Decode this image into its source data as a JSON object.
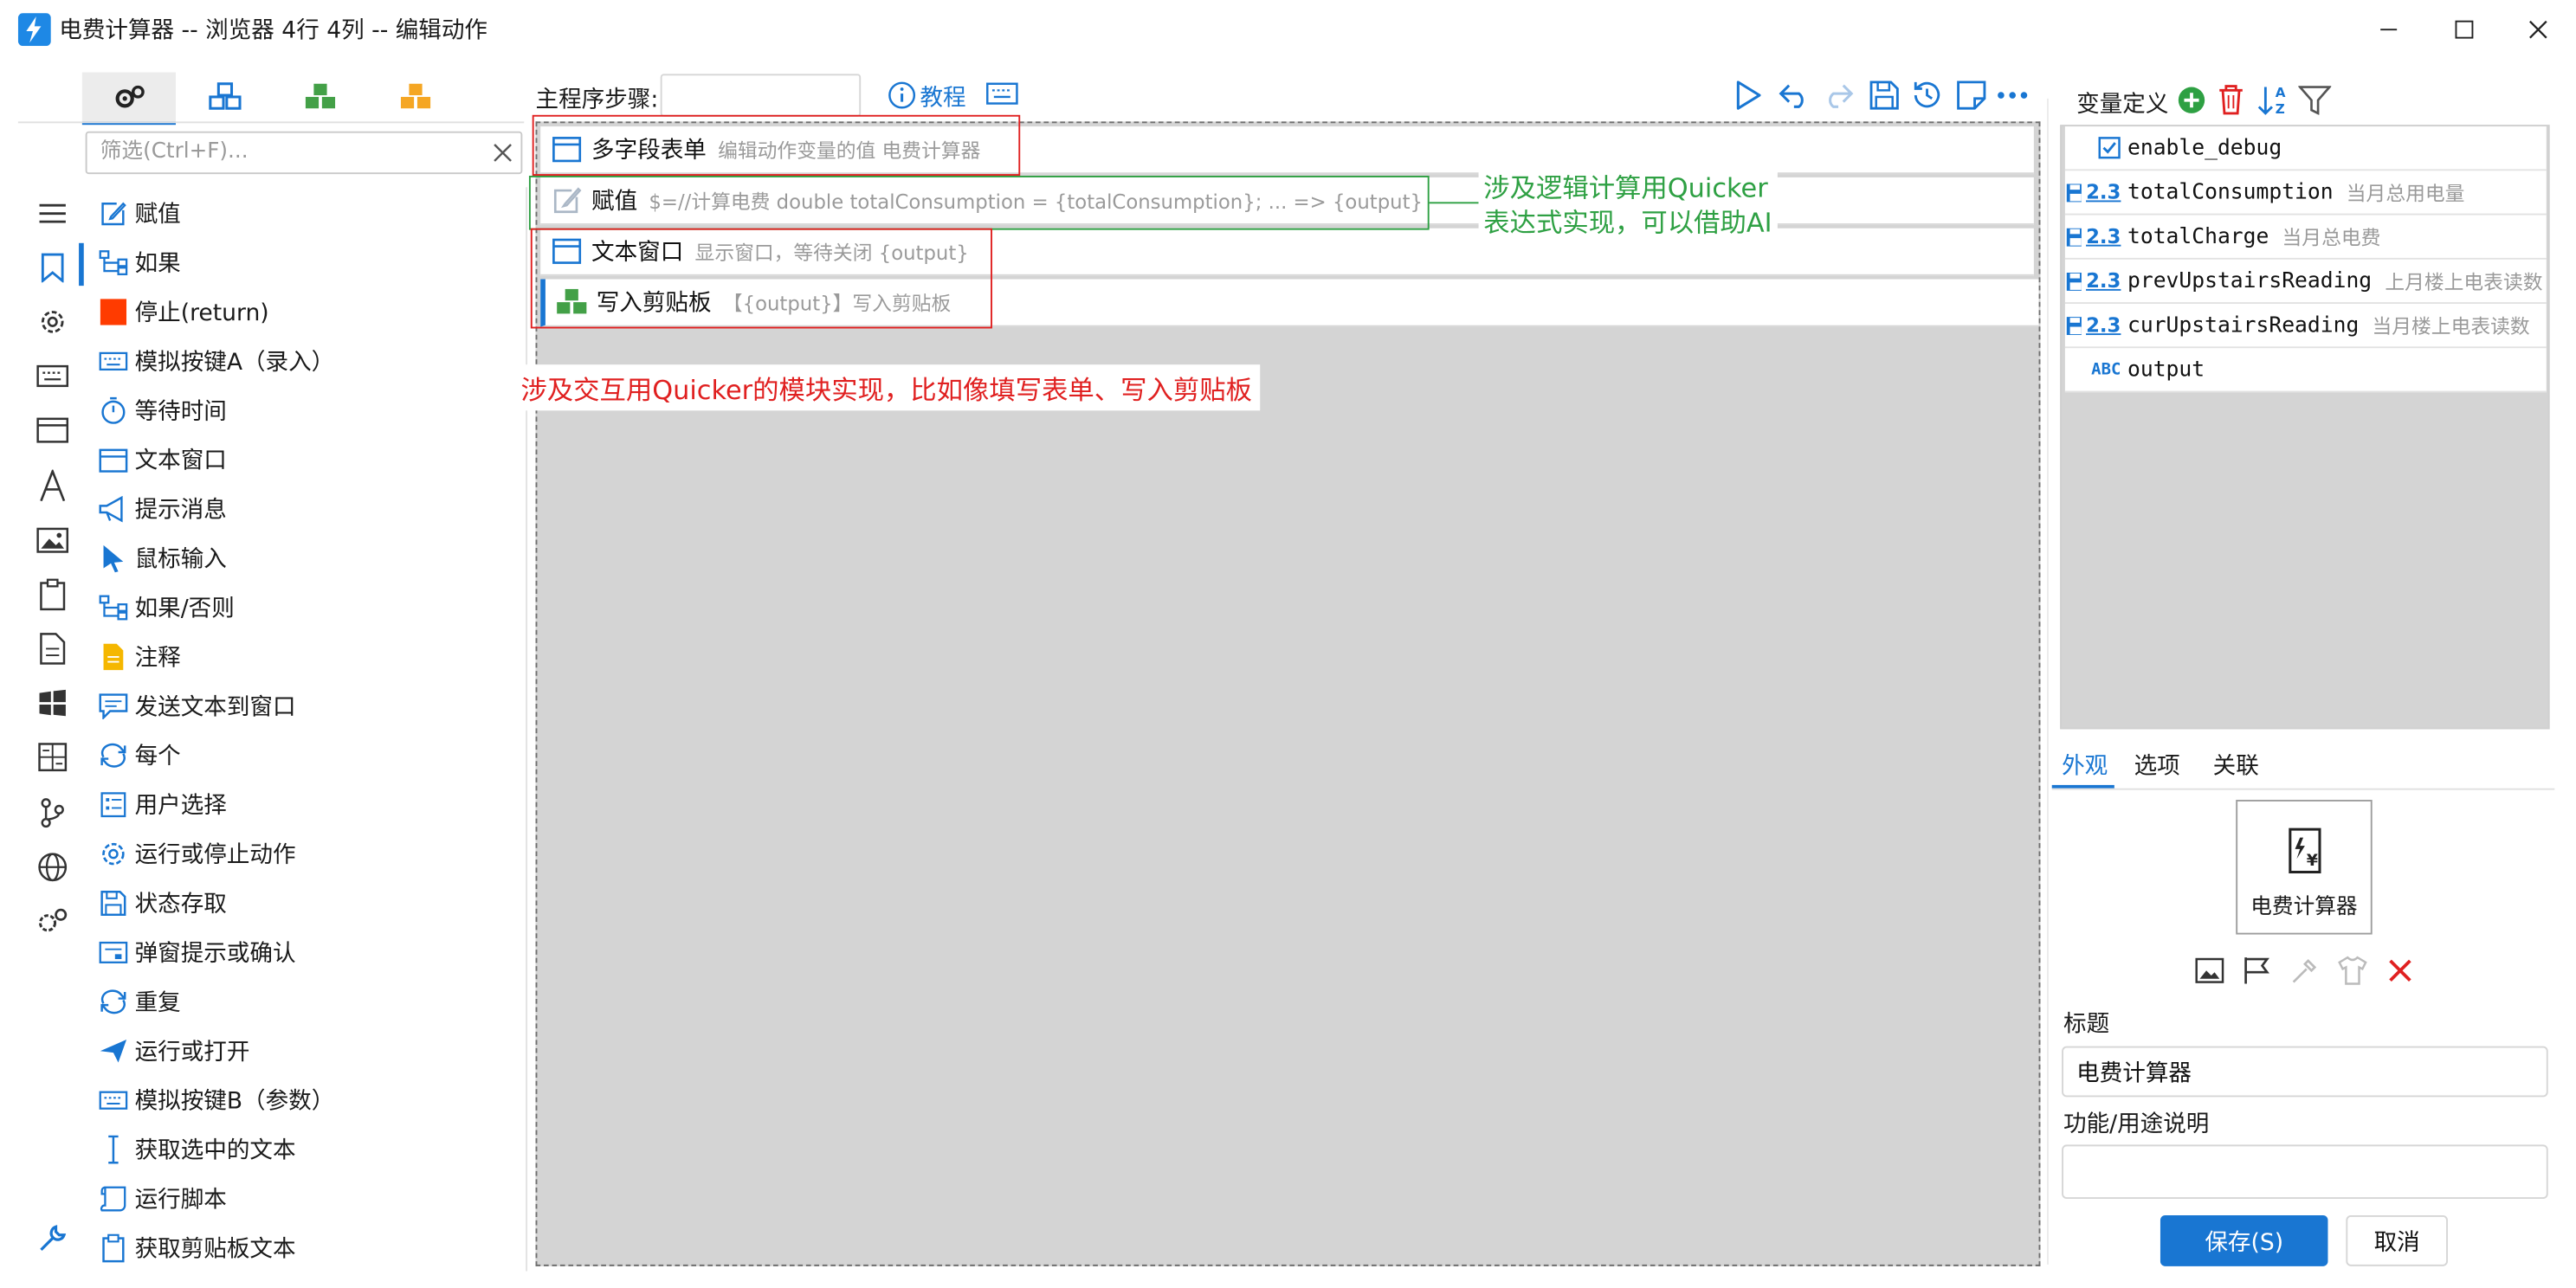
{
  "window": {
    "title": "电费计算器 -- 浏览器 4行 4列 -- 编辑动作"
  },
  "left_panel": {
    "filter_placeholder": "筛选(Ctrl+F)...",
    "actions": [
      {
        "label": "赋值",
        "icon": "edit-icon"
      },
      {
        "label": "如果",
        "icon": "branch-icon"
      },
      {
        "label": "停止(return)",
        "icon": "stop-icon"
      },
      {
        "label": "模拟按键A（录入）",
        "icon": "keyboard-icon"
      },
      {
        "label": "等待时间",
        "icon": "timer-icon"
      },
      {
        "label": "文本窗口",
        "icon": "window-icon"
      },
      {
        "label": "提示消息",
        "icon": "megaphone-icon"
      },
      {
        "label": "鼠标输入",
        "icon": "cursor-icon"
      },
      {
        "label": "如果/否则",
        "icon": "branch-icon"
      },
      {
        "label": "注释",
        "icon": "note-icon"
      },
      {
        "label": "发送文本到窗口",
        "icon": "message-icon"
      },
      {
        "label": "每个",
        "icon": "loop-icon"
      },
      {
        "label": "用户选择",
        "icon": "list-icon"
      },
      {
        "label": "运行或停止动作",
        "icon": "gear-icon"
      },
      {
        "label": "状态存取",
        "icon": "save-icon"
      },
      {
        "label": "弹窗提示或确认",
        "icon": "dialog-icon"
      },
      {
        "label": "重复",
        "icon": "loop-icon"
      },
      {
        "label": "运行或打开",
        "icon": "send-icon"
      },
      {
        "label": "模拟按键B（参数）",
        "icon": "keyboard-icon"
      },
      {
        "label": "获取选中的文本",
        "icon": "text-cursor-icon"
      },
      {
        "label": "运行脚本",
        "icon": "script-icon"
      },
      {
        "label": "获取剪贴板文本",
        "icon": "clipboard-icon"
      }
    ]
  },
  "main": {
    "label": "主程序步骤:",
    "tutorial_label": "教程",
    "steps": [
      {
        "title": "多字段表单",
        "desc": "编辑动作变量的值 电费计算器",
        "icon": "window-icon"
      },
      {
        "title": "赋值",
        "desc": "$=//计算电费  double totalConsumption = {totalConsumption};  ... => {output}",
        "icon": "edit-icon"
      },
      {
        "title": "文本窗口",
        "desc": "显示窗口，等待关闭 {output}",
        "icon": "window-icon"
      },
      {
        "title": "写入剪贴板",
        "desc": "【{output}】写入剪贴板",
        "icon": "module-icon"
      }
    ],
    "green_note": [
      "涉及逻辑计算用Quicker",
      "表达式实现，可以借助AI"
    ],
    "red_note": "涉及交互用Quicker的模块实现，比如像填写表单、写入剪贴板"
  },
  "right_panel": {
    "var_title": "变量定义",
    "variables": [
      {
        "name": "enable_debug",
        "desc": "",
        "type": "bool"
      },
      {
        "name": "totalConsumption",
        "desc": "当月总用电量",
        "type": "number"
      },
      {
        "name": "totalCharge",
        "desc": "当月总电费",
        "type": "number"
      },
      {
        "name": "prevUpstairsReading",
        "desc": "上月楼上电表读数",
        "type": "number"
      },
      {
        "name": "curUpstairsReading",
        "desc": "当月楼上电表读数",
        "type": "number"
      },
      {
        "name": "output",
        "desc": "",
        "type": "text"
      }
    ],
    "number_glyph": "2.3",
    "text_glyph": "ABC",
    "tabs": [
      "外观",
      "选项",
      "关联"
    ],
    "icon_card_label": "电费计算器",
    "title_label": "标题",
    "title_value": "电费计算器",
    "desc_label": "功能/用途说明",
    "desc_value": "",
    "save_label": "保存(S)",
    "cancel_label": "取消"
  },
  "colors": {
    "accent": "#1976d2",
    "annotation_red": "#e02020",
    "annotation_green": "#2ea043"
  }
}
